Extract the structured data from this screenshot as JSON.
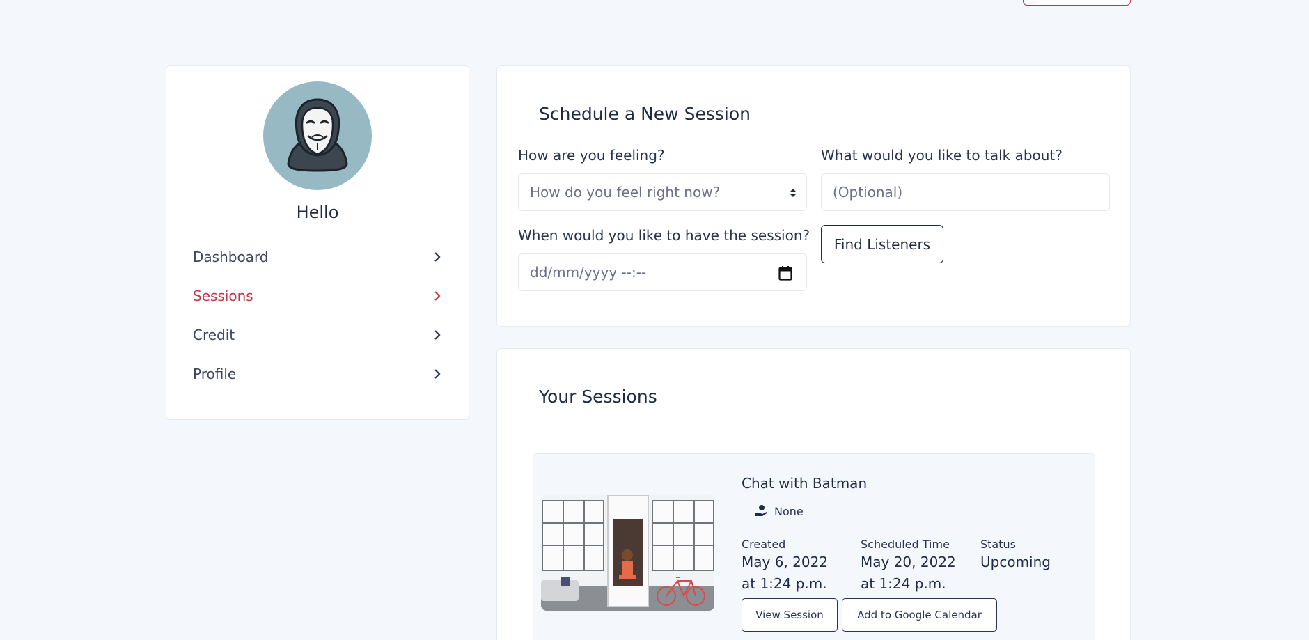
{
  "sidebar": {
    "greeting": "Hello",
    "items": [
      {
        "label": "Dashboard",
        "active": false
      },
      {
        "label": "Sessions",
        "active": true
      },
      {
        "label": "Credit",
        "active": false
      },
      {
        "label": "Profile",
        "active": false
      }
    ]
  },
  "schedule": {
    "title": "Schedule a New Session",
    "feeling_label": "How are you feeling?",
    "feeling_placeholder": "How do you feel right now?",
    "topic_label": "What would you like to talk about?",
    "topic_placeholder": "(Optional)",
    "when_label": "When would you like to have the session?",
    "when_placeholder": "dd/mm/yyyy --:--",
    "find_button": "Find Listeners"
  },
  "sessions": {
    "title": "Your Sessions",
    "items": [
      {
        "title": "Chat with Batman",
        "feeling": "None",
        "created_label": "Created",
        "created_date": "May 6, 2022",
        "created_time": "at 1:24 p.m.",
        "scheduled_label": "Scheduled Time",
        "scheduled_date": "May 20, 2022",
        "scheduled_time": "at 1:24 p.m.",
        "status_label": "Status",
        "status_value": "Upcoming",
        "view_button": "View Session",
        "calendar_button": "Add to Google Calendar"
      }
    ]
  },
  "colors": {
    "accent": "#c0394b",
    "text": "#1f2a44",
    "background": "#f4f7fc",
    "avatar_bg": "#97b9c4"
  }
}
